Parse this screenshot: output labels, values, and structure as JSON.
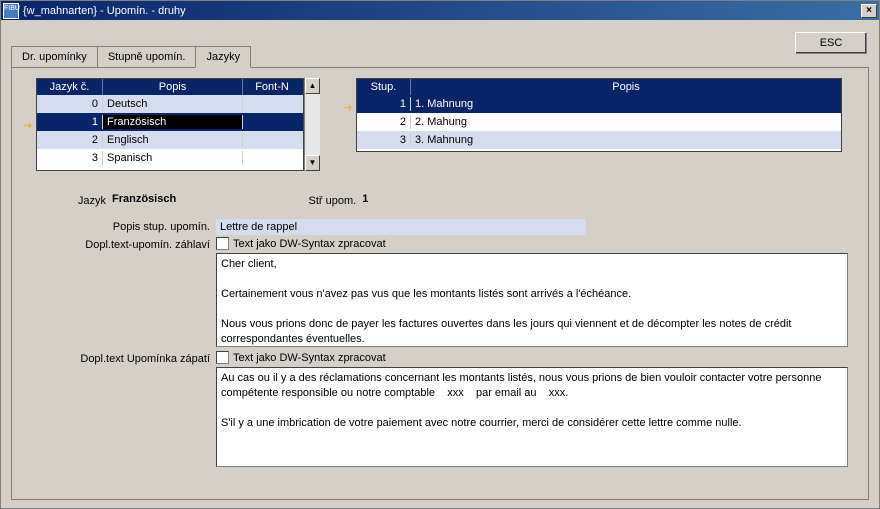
{
  "window": {
    "title": "{w_mahnarten} - Upomín. - druhy",
    "icon_label": "FIBU",
    "close": "×"
  },
  "buttons": {
    "esc": "ESC"
  },
  "tabs": [
    {
      "label": "Dr. upomínky",
      "active": false
    },
    {
      "label": "Stupně upomín.",
      "active": false
    },
    {
      "label": "Jazyky",
      "active": true
    }
  ],
  "lang_grid": {
    "headers": {
      "num": "Jazyk č.",
      "popis": "Popis",
      "font": "Font-N"
    },
    "rows": [
      {
        "num": "0",
        "popis": "Deutsch",
        "sel": false,
        "alt": true,
        "arrow": ""
      },
      {
        "num": "1",
        "popis": "Französisch",
        "sel": true,
        "alt": false,
        "arrow": "➔"
      },
      {
        "num": "2",
        "popis": "Englisch",
        "sel": false,
        "alt": true,
        "arrow": ""
      },
      {
        "num": "3",
        "popis": "Spanisch",
        "sel": false,
        "alt": false,
        "arrow": ""
      }
    ]
  },
  "stup_grid": {
    "headers": {
      "stup": "Stup.",
      "popis": "Popis"
    },
    "rows": [
      {
        "num": "1",
        "popis": "1. Mahnung",
        "sel": true,
        "alt": false,
        "arrow": "➔"
      },
      {
        "num": "2",
        "popis": "2. Mahung",
        "sel": false,
        "alt": false,
        "arrow": ""
      },
      {
        "num": "3",
        "popis": "3. Mahnung",
        "sel": false,
        "alt": true,
        "arrow": ""
      }
    ]
  },
  "form": {
    "jazyk_label": "Jazyk",
    "jazyk_value": "Französisch",
    "stupom_label": "Stř upom.",
    "stupom_value": "1",
    "popis_stup_label": "Popis stup. upomín.",
    "popis_stup_value": "Lettre de rappel",
    "dw_syntax_label": "Text jako DW-Syntax zpracovat",
    "zahlavi_label": "Dopl.text-upomín. záhlaví",
    "zahlavi_text": "Cher client,\n\nCertainement vous n'avez pas vus que les montants listés sont arrivés a l'échéance.\n\nNous vous prions donc de payer les factures ouvertes dans les jours qui viennent et de décompter les notes de crédit correspondantes éventuelles.",
    "zapati_label": "Dopl.text Upomínka zápatí",
    "zapati_text": "Au cas ou il y a des réclamations concernant les montants listés, nous vous prions de bien vouloir contacter votre personne compétente responsible ou notre comptable    xxx    par email au    xxx.\n\nS'il y a une imbrication de votre paiement avec notre courrier, merci de considérer cette lettre comme nulle."
  }
}
